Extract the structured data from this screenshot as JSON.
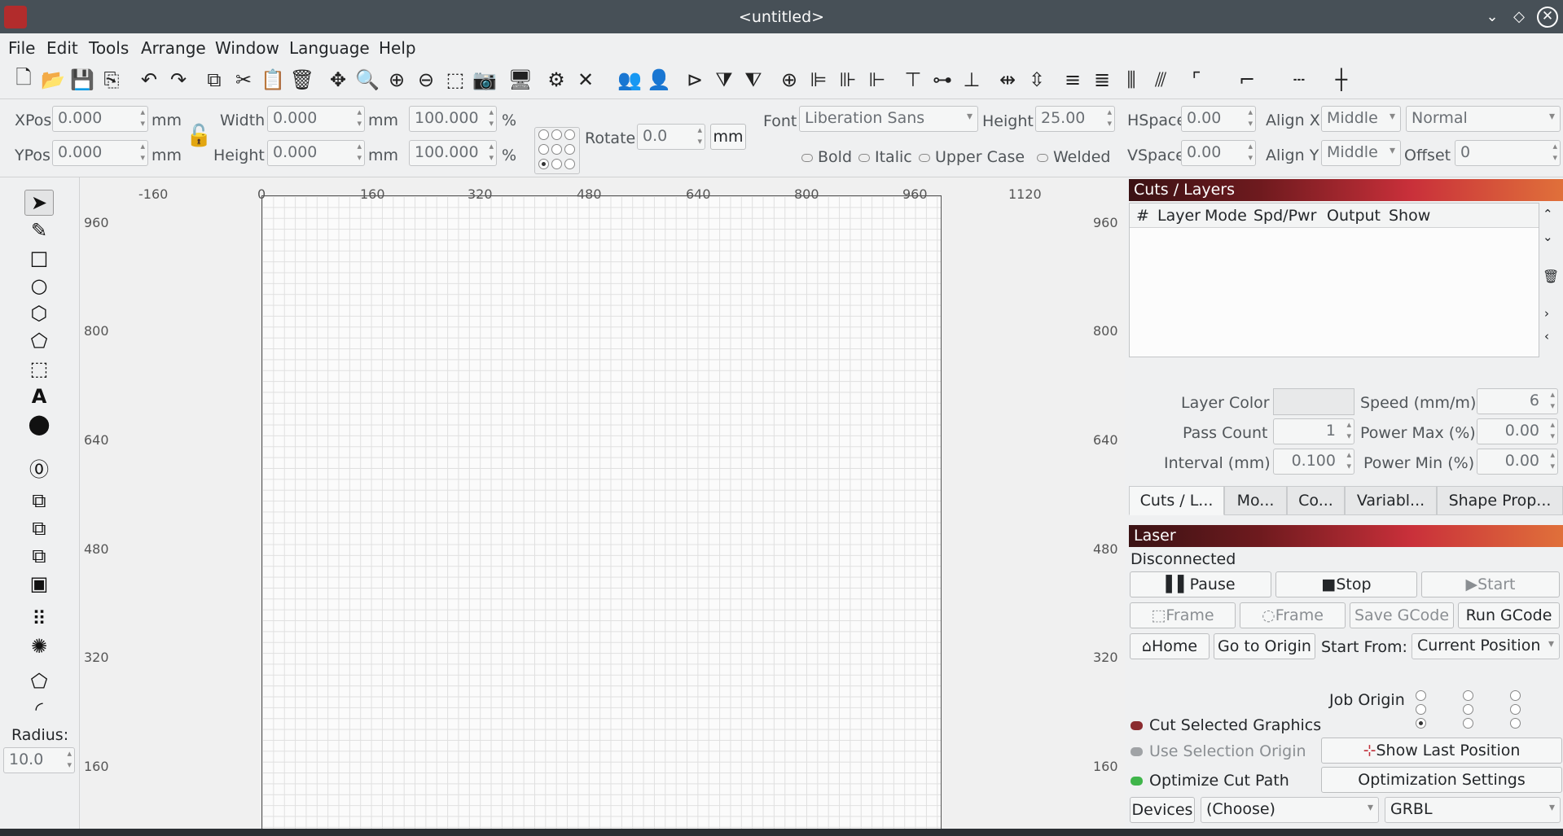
{
  "window": {
    "title": "<untitled>"
  },
  "menu": [
    "File",
    "Edit",
    "Tools",
    "Arrange",
    "Window",
    "Language",
    "Help"
  ],
  "toolbar_icons": [
    "new-file-icon",
    "open-file-icon",
    "save-icon",
    "export-icon",
    "undo-icon",
    "redo-icon",
    "copy-icon",
    "cut-icon",
    "paste-icon",
    "delete-icon",
    "move-icon",
    "zoom-icon",
    "zoom-in-icon",
    "zoom-out-icon",
    "select-frame-icon",
    "camera-icon",
    "monitor-icon",
    "settings-icon",
    "tools-icon",
    "group-icon",
    "ungroup-icon",
    "mirror-h-icon",
    "mirror-v-icon",
    "flip-icon",
    "center-icon",
    "align-left-icon",
    "align-center-icon",
    "align-right-icon",
    "align-top-icon",
    "align-middle-icon",
    "align-bottom-icon",
    "dist-h-icon",
    "dist-v-icon",
    "dist-h2-icon",
    "dist-v2-icon",
    "dist-h3-icon",
    "dist-v3-icon",
    "corner-icon",
    "step-icon",
    "dotted-icon",
    "crosshair-icon"
  ],
  "props": {
    "xpos_label": "XPos",
    "xpos": "0.000",
    "ypos_label": "YPos",
    "ypos": "0.000",
    "unit_mm": "mm",
    "width_label": "Width",
    "width": "0.000",
    "height_label": "Height",
    "height": "0.000",
    "scale_w": "100.000",
    "scale_h": "100.000",
    "pct": "%",
    "rotate_label": "Rotate",
    "rotate": "0.0",
    "rotate_unit": "mm",
    "font_label": "Font",
    "font": "Liberation Sans",
    "font_height_label": "Height",
    "font_height": "25.00",
    "bold": "Bold",
    "italic": "Italic",
    "upper": "Upper Case",
    "welded": "Welded",
    "hspace_label": "HSpace",
    "hspace": "0.00",
    "vspace_label": "VSpace",
    "vspace": "0.00",
    "alignx_label": "Align X",
    "alignx": "Middle",
    "aligny_label": "Align Y",
    "aligny": "Middle",
    "style": "Normal",
    "offset_label": "Offset",
    "offset": "0"
  },
  "left_tools": [
    "select-arrow-icon",
    "pen-icon",
    "rectangle-icon",
    "circle-icon",
    "polygon-icon",
    "pentagon-icon",
    "frame-icon",
    "text-icon",
    "position-marker-icon",
    "offset-icon",
    "boolean-union-icon",
    "boolean-diff-icon",
    "boolean-intersect-icon",
    "weld-icon",
    "grid-array-icon",
    "circular-array-icon",
    "node-edit-icon",
    "corner-round-icon"
  ],
  "radius": {
    "label": "Radius:",
    "value": "10.0"
  },
  "rulers": {
    "top": [
      "-160",
      "0",
      "160",
      "320",
      "480",
      "640",
      "800",
      "960",
      "1120"
    ],
    "left": [
      "960",
      "800",
      "640",
      "480",
      "320",
      "160"
    ],
    "right": [
      "960",
      "800",
      "640",
      "480",
      "320",
      "160"
    ]
  },
  "cuts_layers": {
    "title": "Cuts / Layers",
    "columns": [
      "#",
      "Layer",
      "Mode",
      "Spd/Pwr",
      "Output",
      "Show"
    ],
    "layer_color_label": "Layer Color",
    "speed_label": "Speed (mm/m)",
    "speed": "6",
    "pass_count_label": "Pass Count",
    "pass_count": "1",
    "power_max_label": "Power Max (%)",
    "power_max": "0.00",
    "interval_label": "Interval (mm)",
    "interval": "0.100",
    "power_min_label": "Power Min (%)",
    "power_min": "0.00"
  },
  "tabs": [
    "Cuts / L...",
    "Mo...",
    "Co...",
    "Variabl...",
    "Shape Prop..."
  ],
  "laser": {
    "title": "Laser",
    "status": "Disconnected",
    "pause": "Pause",
    "stop": "Stop",
    "start": "Start",
    "frame1": "Frame",
    "frame2": "Frame",
    "save_gcode": "Save GCode",
    "run_gcode": "Run GCode",
    "home": "Home",
    "go_origin": "Go to Origin",
    "start_from_label": "Start From:",
    "start_from": "Current Position",
    "job_origin_label": "Job Origin",
    "cut_selected": "Cut Selected Graphics",
    "use_selection_origin": "Use Selection Origin",
    "optimize_cut_path": "Optimize Cut Path",
    "show_last_position": "Show Last Position",
    "optimization_settings": "Optimization Settings",
    "devices": "Devices",
    "device_choice": "(Choose)",
    "controller": "GRBL"
  }
}
